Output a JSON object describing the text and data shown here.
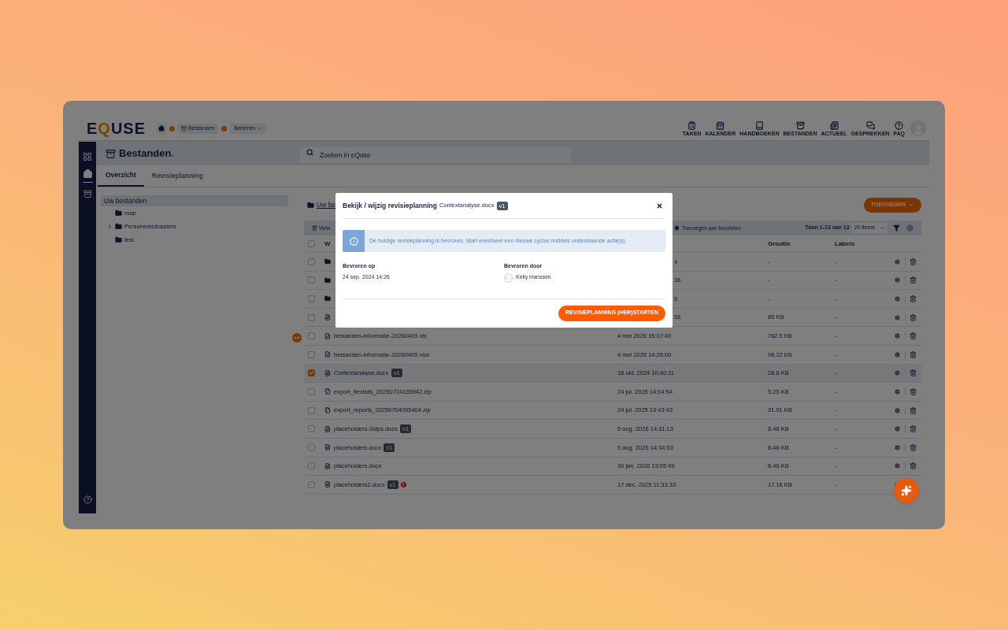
{
  "logo": "EQUSE",
  "breadcrumb": {
    "current": "Bestanden",
    "menu": "Beheren"
  },
  "nav": [
    {
      "kind": "tasks",
      "label": "TAKEN"
    },
    {
      "kind": "calendar",
      "label": "KALENDER"
    },
    {
      "kind": "book",
      "label": "HANDBOEKEN"
    },
    {
      "kind": "archive",
      "label": "BESTANDEN"
    },
    {
      "kind": "news",
      "label": "ACTUEEL"
    },
    {
      "kind": "chat",
      "label": "GESPREKKEN"
    },
    {
      "kind": "help",
      "label": "FAQ"
    }
  ],
  "page": {
    "title": "Bestanden",
    "title_suffix": "."
  },
  "search": {
    "placeholder": "Zoeken in eQuse"
  },
  "tabs": [
    {
      "label": "Overzicht",
      "selected": true
    },
    {
      "label": "Revisieplanning",
      "selected": false
    }
  ],
  "tree": {
    "label": "Uw bestanden",
    "selected": true,
    "children": [
      {
        "label": "map"
      },
      {
        "label": "Personeelsdossiers",
        "expanded": false
      },
      {
        "label": "test"
      }
    ]
  },
  "files": {
    "path": "Uw be",
    "add_button": "TOEVOEGEN",
    "toolbar": {
      "delete": "Verw",
      "favorite": "Toevoegen aan favorieten",
      "count": "Toon 1-13 van 13",
      "page_size": "20 items"
    },
    "select_all": false,
    "columns": {
      "name": "W",
      "size": "Grootte",
      "labels": "Labels"
    },
    "rows": [
      {
        "kind": "folder",
        "date_tail": "4",
        "size": "-",
        "labels": "-",
        "selected": false
      },
      {
        "kind": "folder",
        "date_tail": "36",
        "size": "-",
        "labels": "-",
        "selected": false
      },
      {
        "kind": "folder",
        "date_tail": "5",
        "size": "-",
        "labels": "-",
        "selected": false
      },
      {
        "kind": "word",
        "date_tail": "56",
        "size": "85 KB",
        "labels": "-",
        "selected": false
      },
      {
        "kind": "excel",
        "name": "bestanden-informatie-20260409.xls",
        "warning": false,
        "date": "4 mei 2026 15:07:40",
        "size": "782.5 KB",
        "labels": "-",
        "selected": false
      },
      {
        "kind": "excel",
        "name": "bestanden-informatie-20260409.xlsx",
        "warning": false,
        "date": "4 mei 2026 14:26:00",
        "size": "98.22 KB",
        "labels": "-",
        "selected": false
      },
      {
        "kind": "word",
        "name": "Contextanalyse.docx",
        "version": "v1",
        "warning": false,
        "date": "16 okt. 2024 10:40:11",
        "size": "28.6 KB",
        "labels": "-",
        "selected": true
      },
      {
        "kind": "zip",
        "name": "export_flexlists_20250724135942.zip",
        "warning": false,
        "date": "24 jul. 2025 14:04:54",
        "size": "5.25 KB",
        "labels": "-",
        "selected": false
      },
      {
        "kind": "zip",
        "name": "export_reports_20250704095404.zip",
        "warning": false,
        "date": "24 jul. 2025 13:43:43",
        "size": "31.91 KB",
        "labels": "-",
        "selected": false
      },
      {
        "kind": "word",
        "name": "placeholders-3stps.docx",
        "version": "v1",
        "warning": false,
        "date": "5 aug. 2026 14:31:13",
        "size": "8.46 KB",
        "labels": "-",
        "selected": false
      },
      {
        "kind": "word",
        "name": "placeholders.docx",
        "version": "v1",
        "warning": false,
        "date": "5 aug. 2026 14:34:53",
        "size": "8.46 KB",
        "labels": "-",
        "selected": false
      },
      {
        "kind": "word",
        "name": "placeholders.docx",
        "warning": false,
        "date": "30 jan. 2026 13:05:49",
        "size": "8.46 KB",
        "labels": "-",
        "selected": false
      },
      {
        "kind": "word",
        "name": "placeholders2.docx",
        "version": "v1",
        "warning": true,
        "date": "17 dec. 2025 11:33:33",
        "size": "17.16 KB",
        "labels": "-",
        "selected": false
      }
    ]
  },
  "modal": {
    "title": "Bekijk / wijzig revisieplanning",
    "file": "Contextanalyse.docx",
    "version": "v1",
    "alert": "De huidige revisieplanning is bevroren. Start eventueel een nieuwe cyclus middels onderstaande actie(s).",
    "fields": [
      {
        "label": "Bevroren op",
        "value": "24 sep. 2024 14:26",
        "avatar": false
      },
      {
        "label": "Bevroren door",
        "value": "Kelly Hanssen",
        "avatar": true
      }
    ],
    "button": "REVISIEPLANNING (HER)STARTEN"
  }
}
